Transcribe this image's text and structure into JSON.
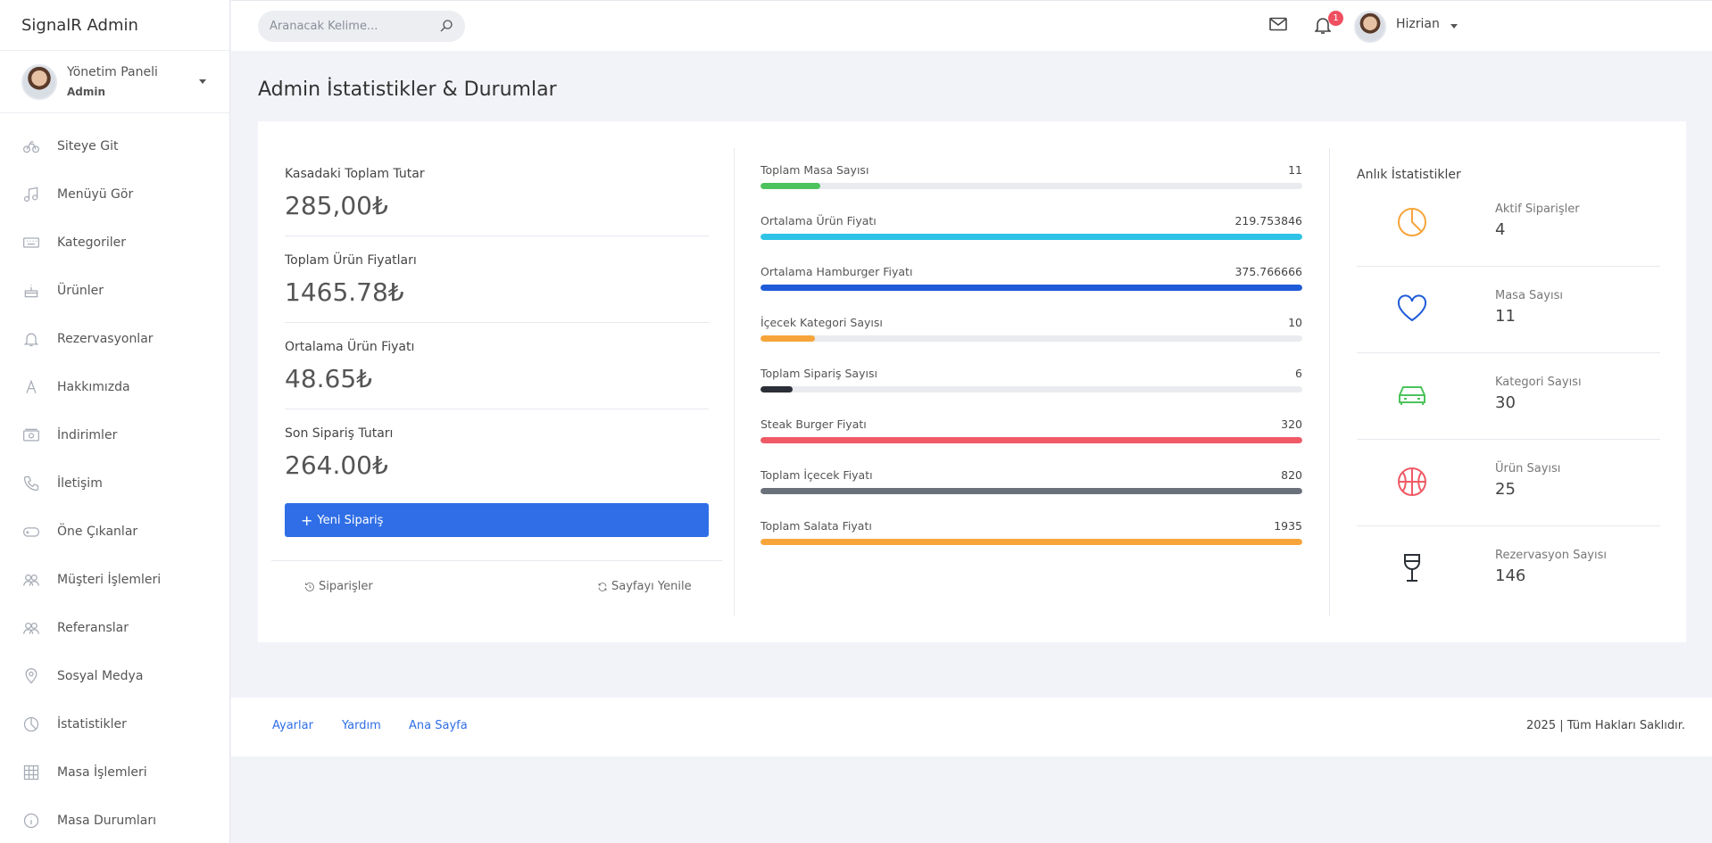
{
  "app": {
    "title": "SignalR Admin"
  },
  "profile": {
    "name": "Yönetim Paneli",
    "role": "Admin"
  },
  "sidebar": {
    "items": [
      {
        "label": "Siteye Git",
        "icon": "bicycle-icon"
      },
      {
        "label": "Menüyü Gör",
        "icon": "music-icon"
      },
      {
        "label": "Kategoriler",
        "icon": "keyboard-icon"
      },
      {
        "label": "Ürünler",
        "icon": "cake-icon"
      },
      {
        "label": "Rezervasyonlar",
        "icon": "bell-icon"
      },
      {
        "label": "Hakkımızda",
        "icon": "font-icon"
      },
      {
        "label": "İndirimler",
        "icon": "money-icon"
      },
      {
        "label": "İletişim",
        "icon": "phone-icon"
      },
      {
        "label": "Öne Çıkanlar",
        "icon": "gamepad-icon"
      },
      {
        "label": "Müşteri İşlemleri",
        "icon": "users-icon"
      },
      {
        "label": "Referanslar",
        "icon": "users-icon"
      },
      {
        "label": "Sosyal Medya",
        "icon": "location-pin-icon"
      },
      {
        "label": "İstatistikler",
        "icon": "pie-chart-icon"
      },
      {
        "label": "Masa İşlemleri",
        "icon": "grid-icon"
      },
      {
        "label": "Masa Durumları",
        "icon": "info-icon"
      }
    ]
  },
  "topbar": {
    "search_placeholder": "Aranacak Kelime...",
    "notification_count": "1",
    "user_name": "Hizrian"
  },
  "page": {
    "title": "Admin İstatistikler & Durumlar"
  },
  "summary": {
    "stats": [
      {
        "label": "Kasadaki Toplam Tutar",
        "value": "285,00₺"
      },
      {
        "label": "Toplam Ürün Fiyatları",
        "value": "1465.78₺"
      },
      {
        "label": "Ortalama Ürün Fiyatı",
        "value": "48.65₺"
      },
      {
        "label": "Son Sipariş Tutarı",
        "value": "264.00₺"
      }
    ],
    "new_order_label": "Yeni Sipariş",
    "orders_link": "Siparişler",
    "refresh_link": "Sayfayı Yenile"
  },
  "progress": [
    {
      "label": "Toplam Masa Sayısı",
      "value": "11",
      "fill": 0.11,
      "color": "#4cc35c"
    },
    {
      "label": "Ortalama Ürün Fiyatı",
      "value": "219.753846",
      "fill": 1.0,
      "color": "#2ec3e6"
    },
    {
      "label": "Ortalama Hamburger Fiyatı",
      "value": "375.766666",
      "fill": 1.0,
      "color": "#1f5bd8"
    },
    {
      "label": "İçecek Kategori Sayısı",
      "value": "10",
      "fill": 0.1,
      "color": "#f7a53a"
    },
    {
      "label": "Toplam Sipariş Sayısı",
      "value": "6",
      "fill": 0.06,
      "color": "#2b2f36"
    },
    {
      "label": "Steak Burger Fiyatı",
      "value": "320",
      "fill": 1.0,
      "color": "#ef5a66"
    },
    {
      "label": "Toplam İçecek Fiyatı",
      "value": "820",
      "fill": 1.0,
      "color": "#6b717a"
    },
    {
      "label": "Toplam Salata Fiyatı",
      "value": "1935",
      "fill": 1.0,
      "color": "#f7a53a"
    }
  ],
  "live": {
    "title": "Anlık İstatistikler",
    "items": [
      {
        "label": "Aktif Siparişler",
        "value": "4",
        "icon": "pie-chart-icon",
        "color": "#f7a53a"
      },
      {
        "label": "Masa Sayısı",
        "value": "11",
        "icon": "heart-icon",
        "color": "#1f5bd8"
      },
      {
        "label": "Kategori Sayısı",
        "value": "30",
        "icon": "car-icon",
        "color": "#4cc35c"
      },
      {
        "label": "Ürün Sayısı",
        "value": "25",
        "icon": "basketball-icon",
        "color": "#ef5a66"
      },
      {
        "label": "Rezervasyon Sayısı",
        "value": "146",
        "icon": "wine-glass-icon",
        "color": "#2b2f36"
      }
    ]
  },
  "footer": {
    "links": [
      "Ayarlar",
      "Yardım",
      "Ana Sayfa"
    ],
    "copyright": "2025 | Tüm Hakları Saklıdır."
  }
}
